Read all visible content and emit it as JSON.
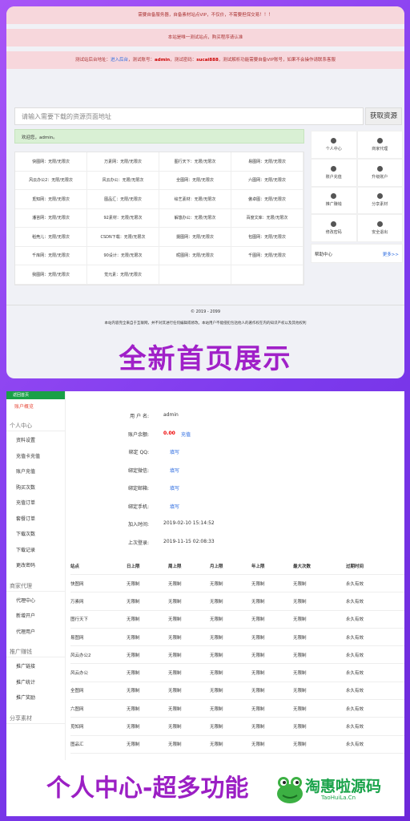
{
  "top": {
    "alerts": {
      "a1": "需要自备服务器，自备素材站点VIP，不仅价，不需要担保交易！！！",
      "a2": "本站是唯一测试站点，购买程序请认准",
      "a3_pre": "测试站后台地址：",
      "a3_link": "进入后台",
      "a3_mid1": "，测试账号：",
      "a3_user": "admin",
      "a3_mid2": "，测试密码：",
      "a3_pass": "sucai888",
      "a3_post": "，测试解析功能需要自备VIP账号，如果不会操作请联系客服"
    },
    "search": {
      "placeholder": "请输入需要下载的资源页面地址",
      "button": "获取资源"
    },
    "welcome": "欢迎您，admin。",
    "grid": [
      "快图网：无限/无限次",
      "万素网：无限/无限次",
      "图行天下：无限/无限次",
      "易图网：无限/无限次",
      "风云办公2：无限/无限次",
      "风云办公：无限/无限次",
      "全图网：无限/无限次",
      "六图网：无限/无限次",
      "觅知网：无限/无限次",
      "图品汇：无限/无限次",
      "绘艺素材：无限/无限次",
      "傲卓图：无限/无限次",
      "潘苔网：无限/无限次",
      "92素材：无限/无限次",
      "解悠办公：无限/无限次",
      "百度文库：无限/无限次",
      "稻壳儿：无限/无限次",
      "CSDN下载：无限/无限次",
      "摄图网：无限/无限次",
      "包图网：无限/无限次",
      "千库网：无限/无限次",
      "90设计：无限/无限次",
      "昵图网：无限/无限次",
      "千图网：无限/无限次",
      "我图网：无限/无限次",
      "觉元素：无限/无限次",
      "",
      ""
    ],
    "side": [
      {
        "label": "个人中心",
        "icon": "user-icon"
      },
      {
        "label": "商家代理",
        "icon": "shop-icon"
      },
      {
        "label": "账户充值",
        "icon": "wallet-icon"
      },
      {
        "label": "升级账户",
        "icon": "upgrade-icon"
      },
      {
        "label": "推广赚钱",
        "icon": "chart-icon"
      },
      {
        "label": "分享素材",
        "icon": "share-icon"
      },
      {
        "label": "修改密码",
        "icon": "lock-icon"
      },
      {
        "label": "安全退出",
        "icon": "logout-icon"
      }
    ],
    "help": {
      "title": "帮助中心",
      "more": "更多>>"
    },
    "footer": {
      "copyright": "© 2019 - 2099",
      "notice": "本站内容完全来自于互联网，并不对其进行任何编辑或修改。本站用户不能侵犯包括他人的著作权在内的知识产权以及其他权利"
    },
    "caption": "全新首页展示"
  },
  "bottom": {
    "nav": {
      "home": "返回首页",
      "overview": "账户概览",
      "groups": [
        {
          "title": "个人中心",
          "items": [
            "资料设置",
            "充值卡充值",
            "账户充值",
            "购买次数",
            "充值订单",
            "套餐订单",
            "下载次数",
            "下载记录",
            "更改密码"
          ]
        },
        {
          "title": "商家代理",
          "items": [
            "代理中心",
            "新增开户",
            "代理用户"
          ]
        },
        {
          "title": "推广赚钱",
          "items": [
            "推广链接",
            "推广统计",
            "推广奖励"
          ]
        },
        {
          "title": "分享素材",
          "items": []
        }
      ]
    },
    "info": [
      {
        "k": "用 户 名:",
        "v": "admin",
        "extra": ""
      },
      {
        "k": "账户余额:",
        "v": "0.00",
        "extra": "充值"
      },
      {
        "k": "绑定 QQ:",
        "v": "",
        "extra": "填写"
      },
      {
        "k": "绑定微信:",
        "v": "",
        "extra": "填写"
      },
      {
        "k": "绑定邮箱:",
        "v": "",
        "extra": "填写"
      },
      {
        "k": "绑定手机:",
        "v": "",
        "extra": "填写"
      },
      {
        "k": "加入时间:",
        "v": "2019-02-10 15:14:52",
        "extra": ""
      },
      {
        "k": "上次登录:",
        "v": "2019-11-15 02:08:33",
        "extra": ""
      }
    ],
    "table": {
      "headers": [
        "站点",
        "日上限",
        "周上限",
        "月上限",
        "年上限",
        "最大次数",
        "过期时间"
      ],
      "rows": [
        [
          "快图网",
          "无限制",
          "无限制",
          "无限制",
          "无限制",
          "无限制",
          "永久有效"
        ],
        [
          "万素网",
          "无限制",
          "无限制",
          "无限制",
          "无限制",
          "无限制",
          "永久有效"
        ],
        [
          "图行天下",
          "无限制",
          "无限制",
          "无限制",
          "无限制",
          "无限制",
          "永久有效"
        ],
        [
          "易图网",
          "无限制",
          "无限制",
          "无限制",
          "无限制",
          "无限制",
          "永久有效"
        ],
        [
          "风云办公2",
          "无限制",
          "无限制",
          "无限制",
          "无限制",
          "无限制",
          "永久有效"
        ],
        [
          "风云办公",
          "无限制",
          "无限制",
          "无限制",
          "无限制",
          "无限制",
          "永久有效"
        ],
        [
          "全图网",
          "无限制",
          "无限制",
          "无限制",
          "无限制",
          "无限制",
          "永久有效"
        ],
        [
          "六图网",
          "无限制",
          "无限制",
          "无限制",
          "无限制",
          "无限制",
          "永久有效"
        ],
        [
          "觅知网",
          "无限制",
          "无限制",
          "无限制",
          "无限制",
          "无限制",
          "永久有效"
        ],
        [
          "图品汇",
          "无限制",
          "无限制",
          "无限制",
          "无限制",
          "无限制",
          "永久有效"
        ]
      ]
    },
    "caption": "个人中心-超多功能",
    "logo": {
      "text": "淘惠啦源码",
      "sub": "TaoHuiLa.Cn"
    }
  }
}
